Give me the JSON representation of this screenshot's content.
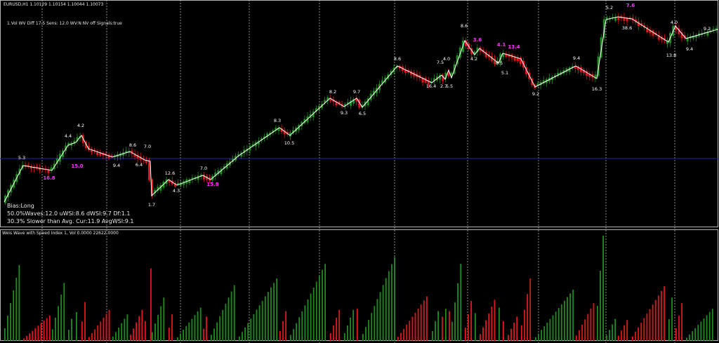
{
  "header": {
    "symbol_quote": "EURUSD,H1 1.10129 1.10154 1.10044 1.10073",
    "indicator_params": "1.Vol  WV Diff 17.5 Sens: 12.0 WV:N NV off Signals:true"
  },
  "info": {
    "bias": "Bias:Long",
    "waves": "50.0%Waves:12.0 uWSI:8.6 dWSI:9.7 Df:1.1",
    "speed": "30.3% Slower than Avg. Cur:11.9 AvgWSI:9.1"
  },
  "subwindow": {
    "title": "Weis Wave with Speed Index 1, Vol  0.0000 22622.0000"
  },
  "colors": {
    "background": "#000000",
    "bull": "#1f8c1f",
    "bear": "#e0161c",
    "zigzag": "#ffffff",
    "signal": "#ff33ff",
    "level_line": "#2323b4",
    "grid": "#c8c8c8"
  },
  "chart_data": {
    "type": "candlestick-with-weis-wave",
    "zigzag_labels": [
      "5.3",
      "16.8",
      "4.4",
      "15.0",
      "4.2",
      "9.4",
      "8.6",
      "6.4",
      "7.0",
      "1.7",
      "12.6",
      "4.3",
      "7.0",
      "15.8",
      "8.3",
      "10.5",
      "8.2",
      "9.3",
      "9.7",
      "6.5",
      "8.6",
      "16.4",
      "7.5",
      "2.7",
      "5.5",
      "4.0",
      "8.6",
      "4.2",
      "3.6",
      "8.5",
      "4.1",
      "5.1",
      "13.4",
      "9.2",
      "9.4",
      "16.3",
      "5.2",
      "7.6",
      "38.6",
      "4.0",
      "13.8",
      "9.4",
      "9.2"
    ],
    "signal_labels": [
      "16.8",
      "15.0",
      "15.8",
      "3.6",
      "4.1",
      "13.4",
      "7.6"
    ]
  }
}
